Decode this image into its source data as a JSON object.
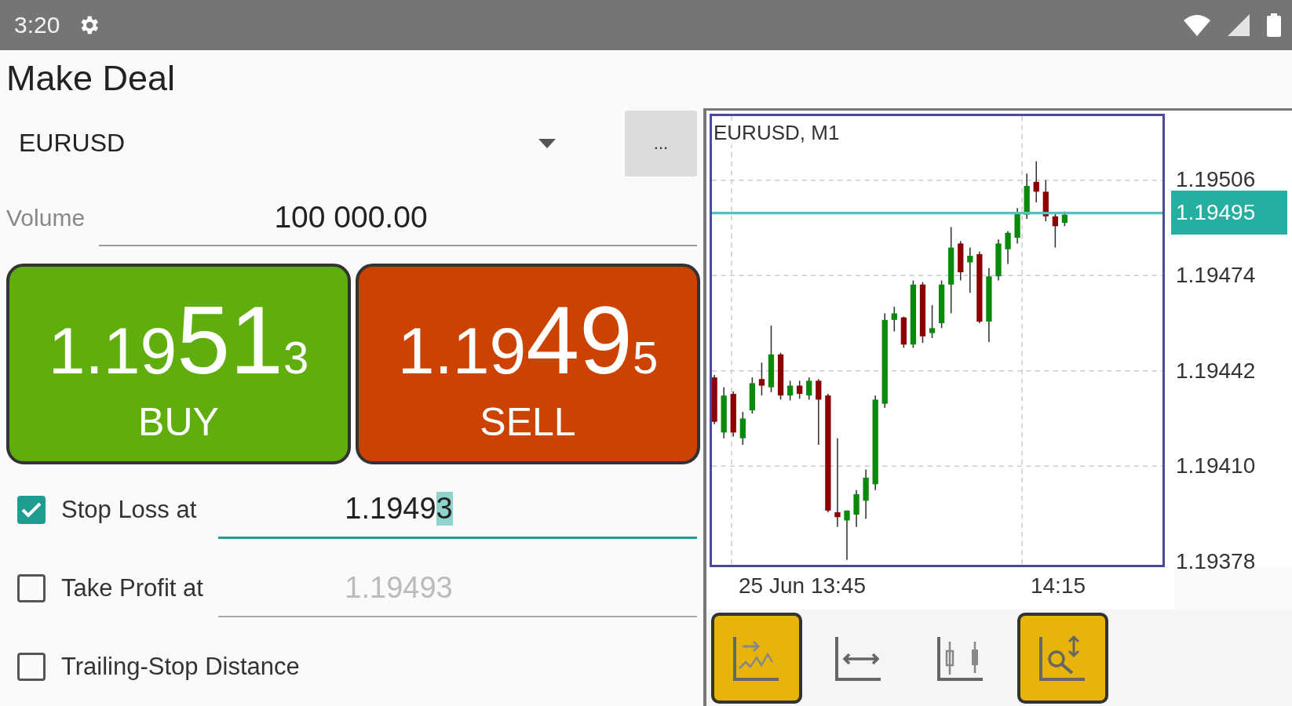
{
  "status_bar": {
    "time": "3:20"
  },
  "title": "Make Deal",
  "symbol": {
    "value": "EURUSD",
    "more_button": "..."
  },
  "volume": {
    "label": "Volume",
    "value": "100 000.00"
  },
  "trade_buttons": [
    {
      "kind": "buy",
      "prefix": "1.19",
      "pips": "51",
      "last": "3",
      "label": "BUY"
    },
    {
      "kind": "sell",
      "prefix": "1.19",
      "pips": "49",
      "last": "5",
      "label": "SELL"
    }
  ],
  "options": [
    {
      "label": "Stop Loss at",
      "checked": true,
      "value": "1.1949",
      "selected_text": "3"
    },
    {
      "label": "Take Profit at",
      "checked": false,
      "placeholder": "1.19493"
    },
    {
      "label": "Trailing-Stop Distance",
      "checked": false
    }
  ],
  "chart": {
    "title": "EURUSD, M1",
    "y_labels": [
      "1.19506",
      "1.19474",
      "1.19442",
      "1.19410",
      "1.19378"
    ],
    "price_tag": "1.19495",
    "x_labels": [
      "25 Jun 13:45",
      "14:15"
    ]
  },
  "chart_tools": [
    {
      "kind": "shift",
      "selected": true
    },
    {
      "kind": "scroll",
      "selected": false
    },
    {
      "kind": "candles",
      "selected": false
    },
    {
      "kind": "zoom",
      "selected": true
    }
  ]
}
